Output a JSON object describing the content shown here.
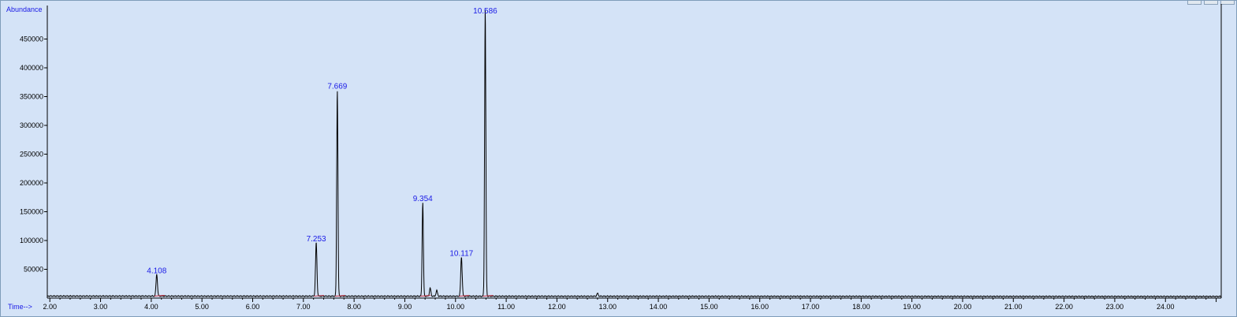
{
  "window": {
    "buttons": [
      "minimize",
      "maximize",
      "close"
    ]
  },
  "chart_data": {
    "type": "line",
    "ylabel": "Abundance",
    "xlabel": "Time-->",
    "xlim": [
      1.95,
      25.1
    ],
    "ylim": [
      0,
      500000
    ],
    "xticks": [
      "2.00",
      "3.00",
      "4.00",
      "5.00",
      "6.00",
      "7.00",
      "8.00",
      "9.00",
      "10.00",
      "11.00",
      "12.00",
      "13.00",
      "14.00",
      "15.00",
      "16.00",
      "17.00",
      "18.00",
      "19.00",
      "20.00",
      "21.00",
      "22.00",
      "23.00",
      "24.00"
    ],
    "yticks": [
      "50000",
      "100000",
      "150000",
      "200000",
      "250000",
      "300000",
      "350000",
      "400000",
      "450000"
    ],
    "grid": false,
    "colors": {
      "background": "#d4e3f7",
      "trace": "#000000",
      "labels": "#1a1ae6",
      "baseline": "#cc3344"
    },
    "peaks": [
      {
        "rt": 4.108,
        "label": "4.108",
        "height": 38000
      },
      {
        "rt": 7.253,
        "label": "7.253",
        "height": 93000
      },
      {
        "rt": 7.669,
        "label": "7.669",
        "height": 358000
      },
      {
        "rt": 9.354,
        "label": "9.354",
        "height": 163000
      },
      {
        "rt": 10.117,
        "label": "10.117",
        "height": 68000
      },
      {
        "rt": 10.586,
        "label": "10.586",
        "height": 500000
      }
    ],
    "minor_peaks": [
      {
        "rt": 9.5,
        "height": 14000
      },
      {
        "rt": 9.63,
        "height": 10000
      },
      {
        "rt": 12.8,
        "height": 5000
      }
    ]
  }
}
